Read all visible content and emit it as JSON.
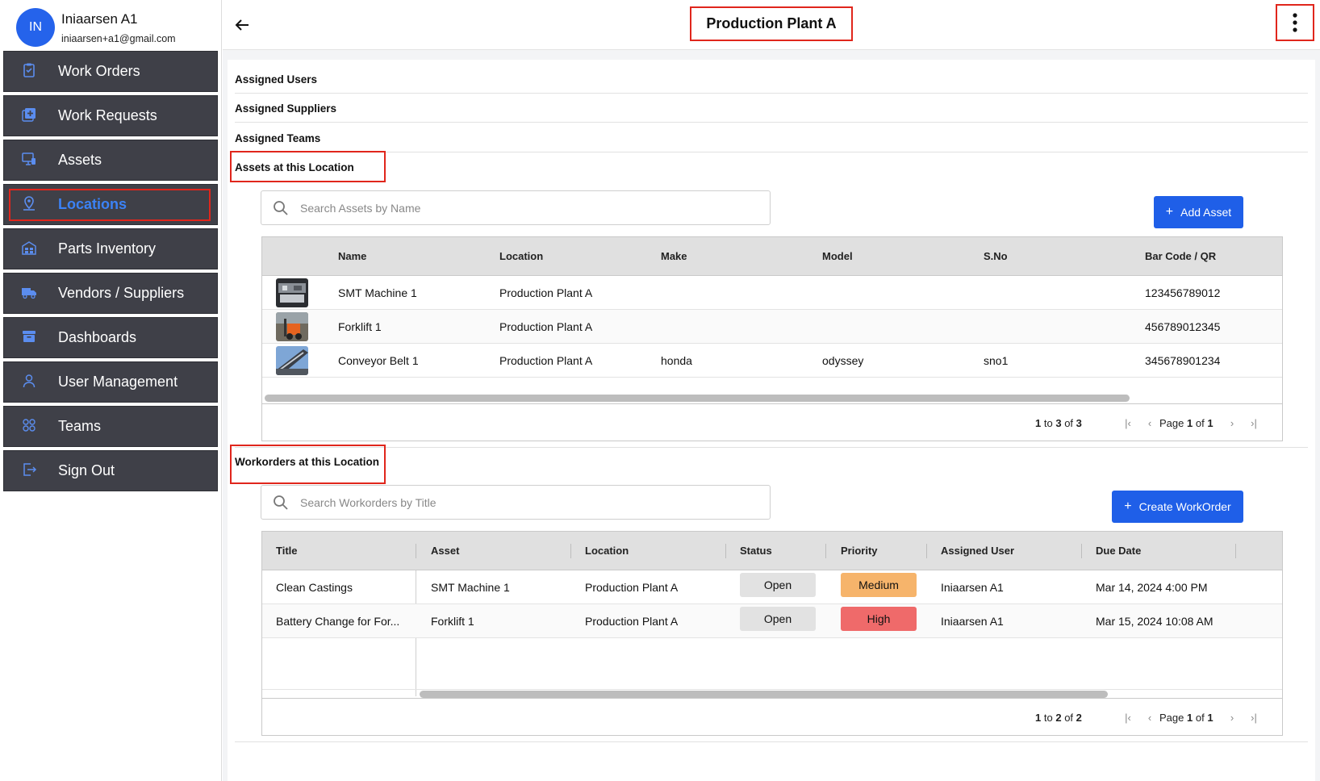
{
  "user": {
    "initials": "IN",
    "name": "Iniaarsen A1",
    "email": "iniaarsen+a1@gmail.com"
  },
  "nav": [
    {
      "label": "Work Orders",
      "icon": "clipboard-icon"
    },
    {
      "label": "Work Requests",
      "icon": "add-request-icon"
    },
    {
      "label": "Assets",
      "icon": "assets-icon"
    },
    {
      "label": "Locations",
      "icon": "location-pin-icon",
      "active": true
    },
    {
      "label": "Parts Inventory",
      "icon": "warehouse-icon"
    },
    {
      "label": "Vendors / Suppliers",
      "icon": "truck-icon"
    },
    {
      "label": "Dashboards",
      "icon": "archive-icon"
    },
    {
      "label": "User Management",
      "icon": "user-icon"
    },
    {
      "label": "Teams",
      "icon": "teams-icon"
    },
    {
      "label": "Sign Out",
      "icon": "sign-out-icon"
    }
  ],
  "page": {
    "title": "Production Plant A"
  },
  "sections": {
    "assigned_users": "Assigned Users",
    "assigned_suppliers": "Assigned Suppliers",
    "assigned_teams": "Assigned Teams",
    "assets": "Assets at this Location",
    "workorders": "Workorders at this Location"
  },
  "assets": {
    "search_placeholder": "Search Assets by Name",
    "add_button": "Add Asset",
    "columns": [
      "Name",
      "Location",
      "Make",
      "Model",
      "S.No",
      "Bar Code / QR"
    ],
    "rows": [
      {
        "name": "SMT Machine 1",
        "location": "Production Plant A",
        "make": "",
        "model": "",
        "sno": "",
        "barcode": "123456789012",
        "thumb": "machine"
      },
      {
        "name": "Forklift 1",
        "location": "Production Plant A",
        "make": "",
        "model": "",
        "sno": "",
        "barcode": "456789012345",
        "thumb": "forklift"
      },
      {
        "name": "Conveyor Belt 1",
        "location": "Production Plant A",
        "make": "honda",
        "model": "odyssey",
        "sno": "sno1",
        "barcode": "345678901234",
        "thumb": "conveyor"
      }
    ],
    "footer": {
      "from": "1",
      "to_word": "to",
      "to": "3",
      "of_word": "of",
      "total": "3",
      "page_word": "Page",
      "page": "1",
      "pages": "1"
    }
  },
  "workorders": {
    "search_placeholder": "Search Workorders by Title",
    "create_button": "Create WorkOrder",
    "columns": [
      "Title",
      "Asset",
      "Location",
      "Status",
      "Priority",
      "Assigned User",
      "Due Date"
    ],
    "rows": [
      {
        "title": "Clean Castings",
        "asset": "SMT Machine 1",
        "location": "Production Plant A",
        "status": "Open",
        "priority": "Medium",
        "user": "Iniaarsen A1",
        "due": "Mar 14, 2024 4:00 PM"
      },
      {
        "title": "Battery Change for For...",
        "asset": "Forklift 1",
        "location": "Production Plant A",
        "status": "Open",
        "priority": "High",
        "user": "Iniaarsen A1",
        "due": "Mar 15, 2024 10:08 AM"
      }
    ],
    "footer": {
      "from": "1",
      "to_word": "to",
      "to": "2",
      "of_word": "of",
      "total": "2",
      "page_word": "Page",
      "page": "1",
      "pages": "1"
    }
  },
  "colors": {
    "accent": "#1f5fe8",
    "nav_bg": "#3f4048",
    "highlight": "#e0261c",
    "medium": "#f6b46b",
    "high": "#ef6a6a"
  }
}
